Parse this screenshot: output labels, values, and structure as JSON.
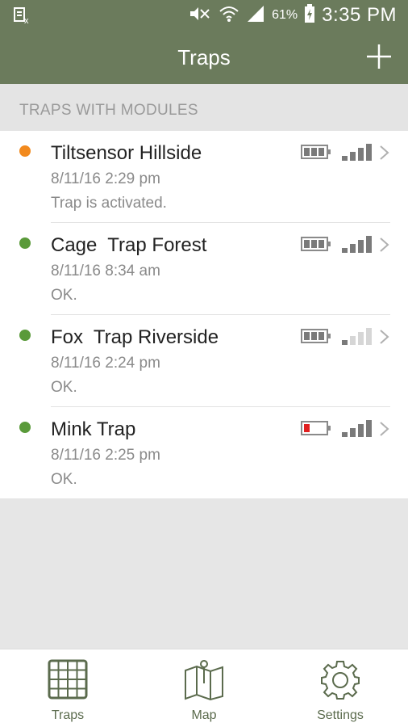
{
  "status_bar": {
    "battery_percent": "61%",
    "time": "3:35 PM"
  },
  "app_bar": {
    "title": "Traps",
    "add_icon": "plus-icon"
  },
  "section": {
    "title": "TRAPS WITH MODULES"
  },
  "traps": [
    {
      "name": "Tiltsensor Hillside",
      "date": "8/11/16 2:29 pm",
      "message": "Trap is activated.",
      "status_color": "#f28a1e",
      "battery_level": 3,
      "battery_low": false,
      "signal_bars": 4
    },
    {
      "name": "Cage  Trap Forest",
      "date": "8/11/16 8:34 am",
      "message": "OK.",
      "status_color": "#5a9a3a",
      "battery_level": 3,
      "battery_low": false,
      "signal_bars": 4
    },
    {
      "name": "Fox  Trap Riverside",
      "date": "8/11/16 2:24 pm",
      "message": "OK.",
      "status_color": "#5a9a3a",
      "battery_level": 3,
      "battery_low": false,
      "signal_bars": 1
    },
    {
      "name": "Mink Trap",
      "date": "8/11/16 2:25 pm",
      "message": "OK.",
      "status_color": "#5a9a3a",
      "battery_level": 1,
      "battery_low": true,
      "signal_bars": 4
    }
  ],
  "bottom_nav": [
    {
      "label": "Traps",
      "icon": "grid-icon",
      "active": true
    },
    {
      "label": "Map",
      "icon": "map-icon",
      "active": false
    },
    {
      "label": "Settings",
      "icon": "gear-icon",
      "active": false
    }
  ],
  "colors": {
    "header_green": "#6b7b5c",
    "nav_green": "#5b6b4d",
    "low_battery_red": "#e02020",
    "icon_gray": "#7a7a7a"
  }
}
